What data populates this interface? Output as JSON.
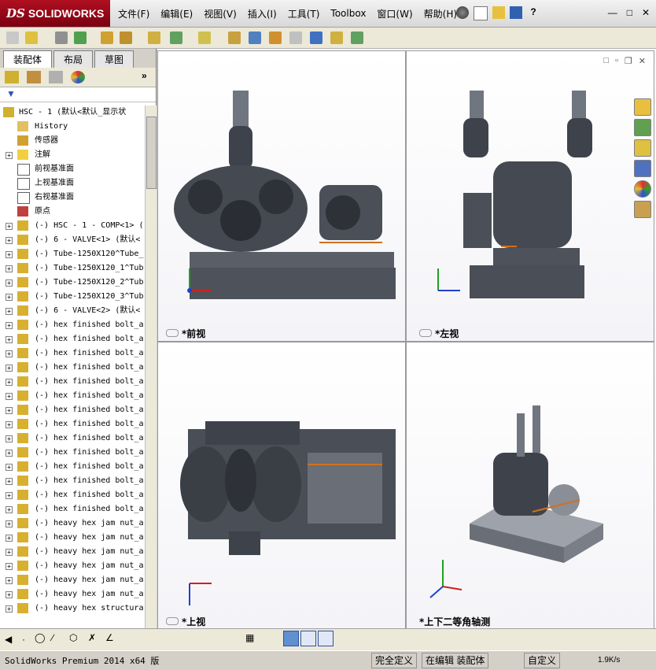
{
  "app": {
    "brand": "SOLIDWORKS",
    "brand_prefix": "DS"
  },
  "menu": [
    "文件(F)",
    "编辑(E)",
    "视图(V)",
    "插入(I)",
    "工具(T)",
    "Toolbox",
    "窗口(W)",
    "帮助(H)"
  ],
  "panel": {
    "tabs": [
      "装配体",
      "布局",
      "草图"
    ],
    "tree": [
      {
        "label": "HSC - 1 (默认<默认_显示状",
        "exp": "",
        "icon": "assembly"
      },
      {
        "label": "History",
        "exp": "",
        "icon": "history"
      },
      {
        "label": "传感器",
        "exp": "",
        "icon": "sensor"
      },
      {
        "label": "注解",
        "exp": "+",
        "icon": "annotation"
      },
      {
        "label": "前视基准面",
        "exp": "",
        "icon": "plane"
      },
      {
        "label": "上视基准面",
        "exp": "",
        "icon": "plane"
      },
      {
        "label": "右视基准面",
        "exp": "",
        "icon": "plane"
      },
      {
        "label": "原点",
        "exp": "",
        "icon": "origin"
      },
      {
        "label": "(-) HSC - 1 - COMP<1> (",
        "exp": "+",
        "icon": "part"
      },
      {
        "label": "(-) 6 - VALVE<1> (默认<",
        "exp": "+",
        "icon": "part"
      },
      {
        "label": "(-) Tube-1250X120^Tube_",
        "exp": "+",
        "icon": "part"
      },
      {
        "label": "(-) Tube-1250X120_1^Tub",
        "exp": "+",
        "icon": "part"
      },
      {
        "label": "(-) Tube-1250X120_2^Tub",
        "exp": "+",
        "icon": "part"
      },
      {
        "label": "(-) Tube-1250X120_3^Tub",
        "exp": "+",
        "icon": "part"
      },
      {
        "label": "(-) 6 - VALVE<2> (默认<",
        "exp": "+",
        "icon": "part"
      },
      {
        "label": "(-) hex finished bolt_a",
        "exp": "+",
        "icon": "part"
      },
      {
        "label": "(-) hex finished bolt_a",
        "exp": "+",
        "icon": "part"
      },
      {
        "label": "(-) hex finished bolt_a",
        "exp": "+",
        "icon": "part"
      },
      {
        "label": "(-) hex finished bolt_a",
        "exp": "+",
        "icon": "part"
      },
      {
        "label": "(-) hex finished bolt_a",
        "exp": "+",
        "icon": "part"
      },
      {
        "label": "(-) hex finished bolt_a",
        "exp": "+",
        "icon": "part"
      },
      {
        "label": "(-) hex finished bolt_a",
        "exp": "+",
        "icon": "part"
      },
      {
        "label": "(-) hex finished bolt_a",
        "exp": "+",
        "icon": "part"
      },
      {
        "label": "(-) hex finished bolt_a",
        "exp": "+",
        "icon": "part"
      },
      {
        "label": "(-) hex finished bolt_a",
        "exp": "+",
        "icon": "part"
      },
      {
        "label": "(-) hex finished bolt_a",
        "exp": "+",
        "icon": "part"
      },
      {
        "label": "(-) hex finished bolt_a",
        "exp": "+",
        "icon": "part"
      },
      {
        "label": "(-) hex finished bolt_a",
        "exp": "+",
        "icon": "part"
      },
      {
        "label": "(-) hex finished bolt_a",
        "exp": "+",
        "icon": "part"
      },
      {
        "label": "(-) heavy hex jam nut_a",
        "exp": "+",
        "icon": "part"
      },
      {
        "label": "(-) heavy hex jam nut_a",
        "exp": "+",
        "icon": "part"
      },
      {
        "label": "(-) heavy hex jam nut_a",
        "exp": "+",
        "icon": "part"
      },
      {
        "label": "(-) heavy hex jam nut_a",
        "exp": "+",
        "icon": "part"
      },
      {
        "label": "(-) heavy hex jam nut_a",
        "exp": "+",
        "icon": "part"
      },
      {
        "label": "(-) heavy hex jam nut_a",
        "exp": "+",
        "icon": "part"
      },
      {
        "label": "(-) heavy hex structura",
        "exp": "+",
        "icon": "part"
      }
    ]
  },
  "views": {
    "front": "*前视",
    "left": "*左视",
    "top": "*上视",
    "iso": "*上下二等角轴测"
  },
  "axes": {
    "x": "X",
    "y": "Y",
    "z": "Z"
  },
  "status": {
    "product": "SolidWorks Premium 2014 x64 版",
    "defined": "完全定义",
    "editing": "在编辑 装配体",
    "custom": "自定义",
    "speed": "1.9K/s"
  },
  "colors": {
    "machine": "#4a4f58",
    "machine_dark": "#2e3238",
    "base": "#5a5e66",
    "accent_orange": "#d07020",
    "brand_red": "#a0101c"
  }
}
